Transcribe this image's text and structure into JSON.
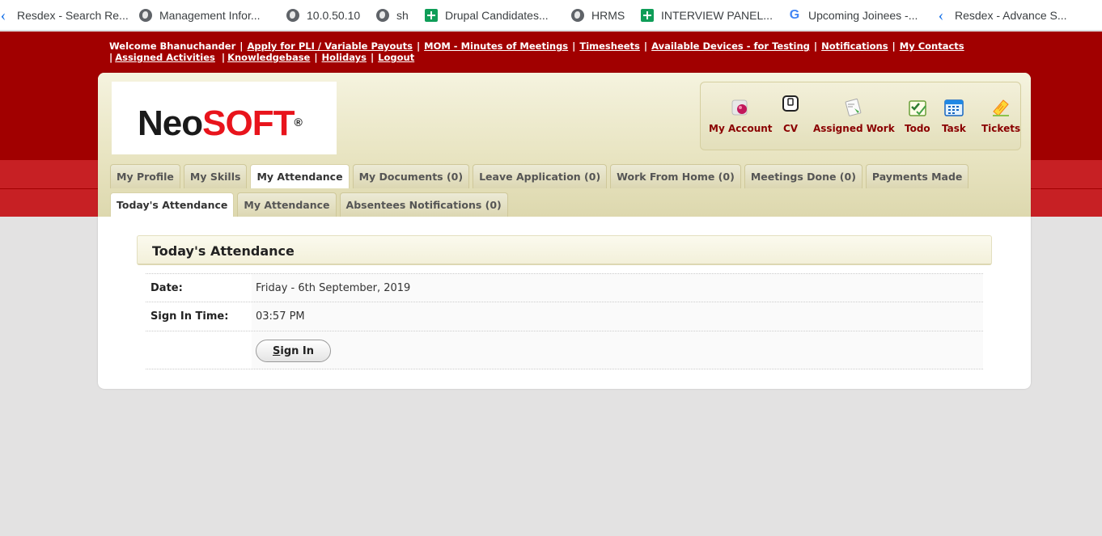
{
  "bookmarks": [
    {
      "label": "Resdex - Search Re...",
      "icon": "resdex-icon"
    },
    {
      "label": "Management Infor...",
      "icon": "globe-icon"
    },
    {
      "label": "10.0.50.10",
      "icon": "globe-icon"
    },
    {
      "label": "sh",
      "icon": "globe-icon"
    },
    {
      "label": "Drupal Candidates...",
      "icon": "sheets-icon"
    },
    {
      "label": "HRMS",
      "icon": "globe-icon"
    },
    {
      "label": "INTERVIEW PANEL...",
      "icon": "sheets-icon"
    },
    {
      "label": "Upcoming Joinees -...",
      "icon": "google-icon"
    },
    {
      "label": "Resdex - Advance S...",
      "icon": "resdex-icon"
    }
  ],
  "topbar": {
    "welcome": "Welcome Bhanuchander",
    "links": [
      "Apply for PLI / Variable Payouts",
      "MOM - Minutes of Meetings",
      "Timesheets",
      "Available Devices - for Testing",
      "Notifications",
      "My Contacts",
      "Assigned Activities",
      "Knowledgebase",
      "Holidays",
      "Logout"
    ]
  },
  "logo": {
    "part1": "Neo",
    "part2": "SOFT",
    "mark": "®"
  },
  "quick_icons": [
    {
      "label": "My Account",
      "icon": "account-icon"
    },
    {
      "label": "CV",
      "icon": "cv-icon"
    },
    {
      "label": "Assigned Work",
      "icon": "assigned-work-icon"
    },
    {
      "label": "Todo",
      "icon": "todo-icon"
    },
    {
      "label": "Task",
      "icon": "calendar-icon"
    },
    {
      "label": "Tickets",
      "icon": "ticket-icon"
    }
  ],
  "main_tabs": [
    {
      "label": "My Profile",
      "active": false
    },
    {
      "label": "My Skills",
      "active": false
    },
    {
      "label": "My Attendance",
      "active": true
    },
    {
      "label": "My Documents (0)",
      "active": false
    },
    {
      "label": "Leave Application (0)",
      "active": false
    },
    {
      "label": "Work From Home (0)",
      "active": false
    },
    {
      "label": "Meetings Done (0)",
      "active": false
    },
    {
      "label": "Payments Made",
      "active": false
    }
  ],
  "sub_tabs": [
    {
      "label": "Today's Attendance",
      "active": true
    },
    {
      "label": "My Attendance",
      "active": false
    },
    {
      "label": "Absentees Notifications (0)",
      "active": false
    }
  ],
  "attendance": {
    "title": "Today's Attendance",
    "date_label": "Date:",
    "date_value": "Friday - 6th September, 2019",
    "signin_label": "Sign In Time:",
    "signin_value": "03:57 PM",
    "button_first": "S",
    "button_rest": "ign In"
  },
  "colors": {
    "header_red": "#a10000",
    "stripe_red": "#c72024",
    "link_dark_red": "#8a0000"
  }
}
